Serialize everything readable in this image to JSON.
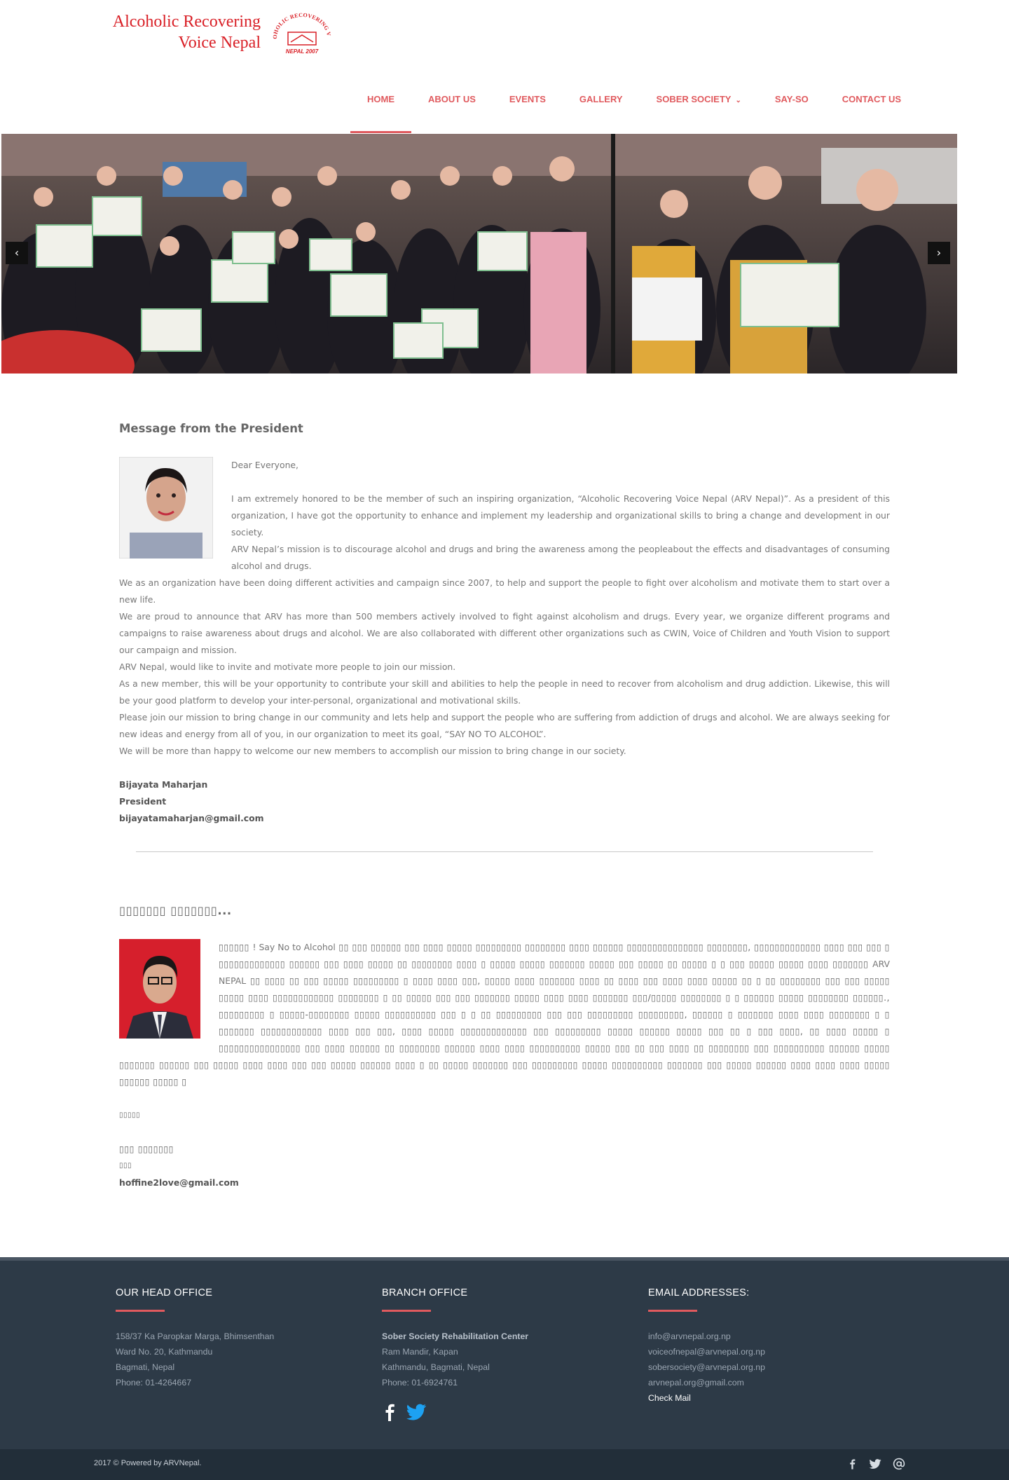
{
  "brand": {
    "line1": "Alcoholic Recovering",
    "line2": "Voice Nepal",
    "seal_text": "ALCOHOLIC RECOVERING VOICE",
    "seal_year": "NEPAL 2007",
    "color": "#d91f26"
  },
  "nav": {
    "items": [
      "HOME",
      "ABOUT US",
      "EVENTS",
      "GALLERY",
      "SOBER SOCIETY",
      "SAY-SO",
      "CONTACT US"
    ],
    "active": "HOME",
    "accent": "#e05a5e"
  },
  "slider": {
    "prev_icon": "chevron-left-icon",
    "next_icon": "chevron-right-icon"
  },
  "president": {
    "title": "Message from the President",
    "greeting": "Dear Everyone,",
    "p1": "I am extremely honored to be the member of such an inspiring organization, “Alcoholic Recovering Voice Nepal (ARV Nepal)”. As a president of this organization, I have got the opportunity to enhance and implement my leadership and organizational skills to bring a change and development in our society.",
    "p2": "ARV Nepal’s mission is to discourage alcohol and drugs and bring the awareness among the peopleabout the effects and disadvantages of consuming alcohol and drugs.",
    "p3": "We as an organization have been doing different activities and campaign since 2007, to help and support the people to fight over alcoholism and motivate them to start over a new life.",
    "p4": "We are proud to announce that ARV has more than 500 members actively involved to fight against alcoholism and drugs. Every year, we organize different programs and campaigns to raise awareness about drugs and alcohol. We are also collaborated with different other organizations such as CWIN, Voice of Children and Youth Vision to support our campaign and mission.",
    "p5": "ARV Nepal, would like to invite and motivate more people to join our mission.",
    "p6": "As a new member, this will be your opportunity to contribute your skill and abilities to help the people in need to recover from alcoholism and drug addiction. Likewise, this will be your good platform to develop your inter-personal, organizational and motivational skills.",
    "p7": "Please join our mission to bring change in our community and lets help and support the people who are suffering from addiction of drugs and alcohol. We are always seeking for new ideas and energy from all of you, in our organization to meet its goal, “SAY NO TO ALCOHOL”.",
    "p8": "We will be more than happy to welcome our new members to accomplish our mission to bring change in our society.",
    "name": "Bijayata Maharjan",
    "role": "President",
    "email": "bijayatamaharjan@gmail.com"
  },
  "second": {
    "title": "▯▯▯▯▯▯▯ ▯▯▯▯▯▯▯...",
    "lead": "▯▯▯▯▯▯",
    "say_no": "! Say No to Alcohol",
    "body": "▯▯ ▯▯▯ ▯▯▯▯▯▯ ▯▯▯ ▯▯▯▯ ▯▯▯▯▯ ▯▯▯▯▯▯▯▯▯ ▯▯▯▯▯▯▯▯ ▯▯▯▯ ▯▯▯▯▯▯ ▯▯▯▯▯▯▯▯▯▯▯▯▯▯▯ ▯▯▯▯▯▯▯▯, ▯▯▯▯▯▯▯▯▯▯▯▯▯ ▯▯▯▯ ▯▯▯ ▯▯▯ ▯ ▯▯▯▯▯▯▯▯▯▯▯▯▯ ▯▯▯▯▯▯ ▯▯▯ ▯▯▯▯ ▯▯▯▯▯ ▯▯ ▯▯▯▯▯▯▯▯ ▯▯▯▯ ▯ ▯▯▯▯▯ ▯▯▯▯▯ ▯▯▯▯▯▯▯ ▯▯▯▯▯ ▯▯▯ ▯▯▯▯▯ ▯▯ ▯▯▯▯▯ ▯ ▯ ▯▯▯ ▯▯▯▯▯ ▯▯▯▯▯ ▯▯▯▯ ▯▯▯▯▯▯▯",
    "arv": "ARV NEPAL",
    "body2": "▯▯ ▯▯▯▯ ▯▯ ▯▯▯ ▯▯▯▯▯ ▯▯▯▯▯▯▯▯▯ ▯ ▯▯▯▯ ▯▯▯▯ ▯▯▯, ▯▯▯▯▯ ▯▯▯▯ ▯▯▯▯▯▯▯ ▯▯▯▯ ▯▯ ▯▯▯▯ ▯▯▯ ▯▯▯▯ ▯▯▯▯ ▯▯▯▯▯ ▯▯ ▯ ▯▯ ▯▯▯▯▯▯▯▯ ▯▯▯ ▯▯▯ ▯▯▯▯▯ ▯▯▯▯▯ ▯▯▯▯ ▯▯▯▯▯▯▯▯▯▯▯▯ ▯▯▯▯▯▯▯▯ ▯ ▯▯ ▯▯▯▯▯ ▯▯▯ ▯▯▯ ▯▯▯▯▯▯▯ ▯▯▯▯▯ ▯▯▯▯ ▯▯▯▯ ▯▯▯▯▯▯▯ ▯▯▯/▯▯▯▯▯ ▯▯▯▯▯▯▯▯ ▯ ▯ ▯▯▯▯▯▯ ▯▯▯▯▯ ▯▯▯▯▯▯▯▯ ▯▯▯▯▯▯., ▯▯▯▯▯▯▯▯▯ ▯ ▯▯▯▯▯-▯▯▯▯▯▯▯▯ ▯▯▯▯▯ ▯▯▯▯▯▯▯▯▯▯ ▯▯▯ ▯ ▯ ▯▯ ▯▯▯▯▯▯▯▯▯ ▯▯▯ ▯▯▯ ▯▯▯▯▯▯▯▯▯ ▯▯▯▯▯▯▯▯▯, ▯▯▯▯▯▯ ▯ ▯▯▯▯▯▯▯ ▯▯▯▯ ▯▯▯▯ ▯▯▯▯▯▯▯▯ ▯ ▯ ▯▯▯▯▯▯▯ ▯▯▯▯▯▯▯▯▯▯▯▯ ▯▯▯▯ ▯▯▯ ▯▯▯, ▯▯▯▯ ▯▯▯▯▯ ▯▯▯▯▯▯▯▯▯▯▯▯▯ ▯▯▯ ▯▯▯▯▯▯▯▯▯ ▯▯▯▯▯ ▯▯▯▯▯▯ ▯▯▯▯▯ ▯▯▯ ▯▯ ▯ ▯▯▯ ▯▯▯▯, ▯▯ ▯▯▯▯ ▯▯▯▯▯ ▯ ▯▯▯▯▯▯▯▯▯▯▯▯▯▯▯▯ ▯▯▯ ▯▯▯▯ ▯▯▯▯▯▯ ▯▯ ▯▯▯▯▯▯▯▯ ▯▯▯▯▯▯ ▯▯▯▯ ▯▯▯▯ ▯▯▯▯▯▯▯▯▯▯ ▯▯▯▯▯ ▯▯▯ ▯▯ ▯▯▯ ▯▯▯▯ ▯▯ ▯▯▯▯▯▯▯▯ ▯▯▯ ▯▯▯▯▯▯▯▯▯▯ ▯▯▯▯▯▯ ▯▯▯▯▯ ▯▯▯▯▯▯▯ ▯▯▯▯▯▯ ▯▯▯ ▯▯▯▯▯ ▯▯▯▯ ▯▯▯▯ ▯▯▯ ▯▯▯ ▯▯▯▯▯ ▯▯▯▯▯▯ ▯▯▯▯ ▯ ▯▯ ▯▯▯▯▯ ▯▯▯▯▯▯▯ ▯▯▯ ▯▯▯▯▯▯▯▯▯ ▯▯▯▯▯ ▯▯▯▯▯▯▯▯▯▯ ▯▯▯▯▯▯▯ ▯▯▯ ▯▯▯▯▯ ▯▯▯▯▯▯ ▯▯▯▯ ▯▯▯▯ ▯▯▯▯ ▯▯▯▯▯ ▯▯▯▯▯▯ ▯▯▯▯▯ ▯",
    "closing": "▯▯▯▯▯",
    "name": "▯▯▯ ▯▯▯▯▯▯▯",
    "role": "▯▯▯",
    "email": "hoffine2love@gmail.com"
  },
  "footer": {
    "head_office": {
      "title": "OUR HEAD OFFICE",
      "lines": [
        "158/37 Ka Paropkar Marga, Bhimsenthan",
        "Ward No. 20, Kathmandu",
        "Bagmati, Nepal",
        "Phone: 01-4264667"
      ]
    },
    "branch_office": {
      "title": "BRANCH OFFICE",
      "name": "Sober Society Rehabilitation Center",
      "lines": [
        "Ram Mandir, Kapan",
        "Kathmandu, Bagmati, Nepal",
        "Phone: 01-6924761"
      ],
      "social_icons": [
        "facebook-icon",
        "twitter-icon"
      ]
    },
    "emails": {
      "title": "EMAIL ADDRESSES:",
      "lines": [
        "info@arvnepal.org.np",
        "voiceofnepal@arvnepal.org.np",
        "sobersociety@arvnepal.org.np",
        "arvnepal.org@gmail.com"
      ],
      "check_mail": "Check Mail"
    },
    "copyright": "2017 © Powered by ARVNepal.",
    "bottom_icons": [
      "facebook-icon",
      "twitter-icon",
      "email-icon"
    ],
    "bg": "#2d3a47"
  }
}
